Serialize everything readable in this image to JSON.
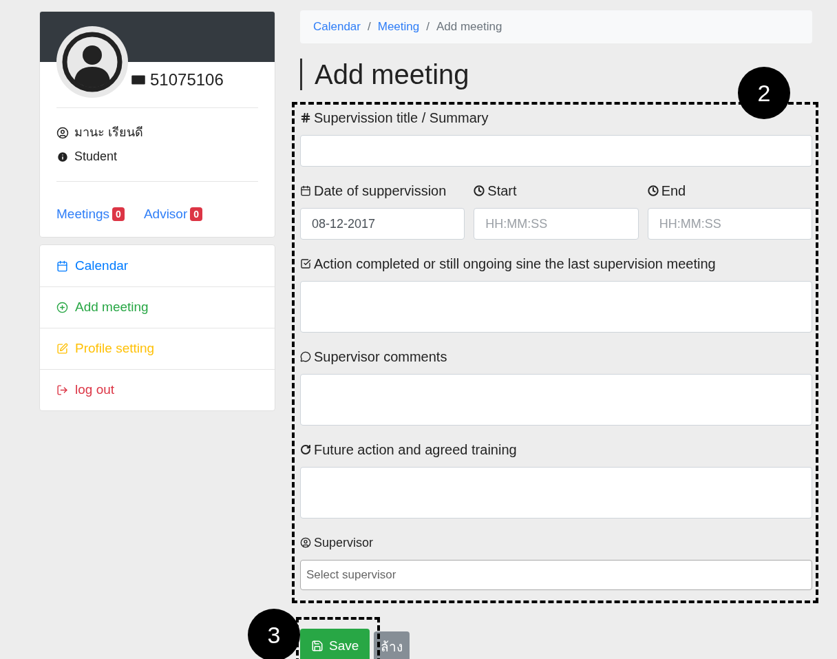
{
  "profile": {
    "student_id": "51075106",
    "name": "มานะ เรียนดี",
    "role": "Student",
    "links": [
      {
        "label": "Meetings",
        "count": "0"
      },
      {
        "label": "Advisor",
        "count": "0"
      }
    ]
  },
  "menu": [
    {
      "label": "Calendar",
      "color": "#007bff"
    },
    {
      "label": "Add meeting",
      "color": "#28a745"
    },
    {
      "label": "Profile setting",
      "color": "#ffc107"
    },
    {
      "label": "log out",
      "color": "#dc3545"
    }
  ],
  "breadcrumb": [
    {
      "label": "Calendar",
      "link": true
    },
    {
      "separator": "/",
      "label": "Meeting",
      "link": true
    },
    {
      "separator": "/",
      "label": "Add meeting",
      "link": false
    }
  ],
  "title": "Add meeting",
  "rows": [
    {
      "fields": [
        {
          "kind": "input",
          "label": "Supervission title / Summary"
        }
      ]
    },
    {
      "fields": [
        {
          "kind": "input",
          "label": "Date of suppervission",
          "value": "08-12-2017"
        },
        {
          "kind": "input",
          "label": "Start",
          "placeholder": "HH:MM:SS"
        },
        {
          "kind": "input",
          "label": "End",
          "placeholder": "HH:MM:SS"
        }
      ]
    },
    {
      "fields": [
        {
          "kind": "textarea",
          "label": "Action completed or still ongoing sine the last supervision meeting"
        }
      ]
    },
    {
      "fields": [
        {
          "kind": "textarea",
          "label": "Supervisor comments"
        }
      ]
    },
    {
      "fields": [
        {
          "kind": "textarea",
          "label": "Future action and agreed training"
        }
      ]
    },
    {
      "fields": [
        {
          "kind": "select",
          "label": "Supervisor",
          "placeholder": "Select supervisor"
        }
      ]
    }
  ],
  "buttons": [
    {
      "label": "Save",
      "kind": "primary"
    },
    {
      "label": "ล้าง",
      "kind": "secondary"
    }
  ],
  "callouts": [
    "2",
    "3"
  ]
}
